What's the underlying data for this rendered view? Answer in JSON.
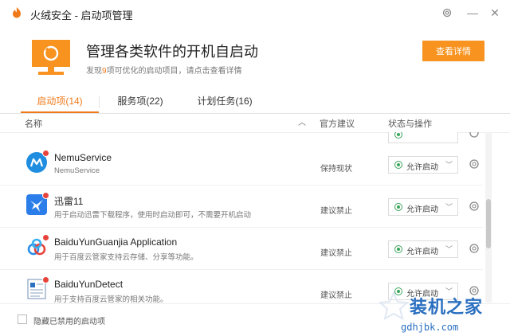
{
  "window": {
    "title": "火绒安全 - 启动项管理",
    "controls": [
      "settings-icon",
      "minimize-icon",
      "close-icon"
    ]
  },
  "header": {
    "title": "管理各类软件的开机自启动",
    "subtitle_prefix": "发现",
    "subtitle_count": "9",
    "subtitle_suffix": "项可优化的启动项目，请点击查看详情",
    "detail_button": "查看详情",
    "accent": "#f7931e"
  },
  "tabs": [
    {
      "label": "启动项(14)",
      "active": true
    },
    {
      "label": "服务项(22)",
      "active": false
    },
    {
      "label": "计划任务(16)",
      "active": false
    }
  ],
  "columns": {
    "name": "名称",
    "advice": "官方建议",
    "status": "状态与操作"
  },
  "rows": [
    {
      "name": "NemuService",
      "desc": "NemuService",
      "advice": "保持现状",
      "status": "允许启动",
      "icon": "nemu-icon"
    },
    {
      "name": "迅雷11",
      "desc": "用于启动迅雷下载程序，使用时启动即可，不需要开机启动",
      "advice": "建议禁止",
      "status": "允许启动",
      "icon": "thunder-icon"
    },
    {
      "name": "BaiduYunGuanjia Application",
      "desc": "用于百度云管家支持云存储、分享等功能。",
      "advice": "建议禁止",
      "status": "允许启动",
      "icon": "baiduyun-icon"
    },
    {
      "name": "BaiduYunDetect",
      "desc": "用于支持百度云管家的相关功能。",
      "advice": "建议禁止",
      "status": "允许启动",
      "icon": "document-icon"
    }
  ],
  "footer": {
    "hide_disabled_label": "隐藏已禁用的启动项"
  },
  "watermark": {
    "main": "装机之家",
    "sub": "gdhjbk.com"
  }
}
